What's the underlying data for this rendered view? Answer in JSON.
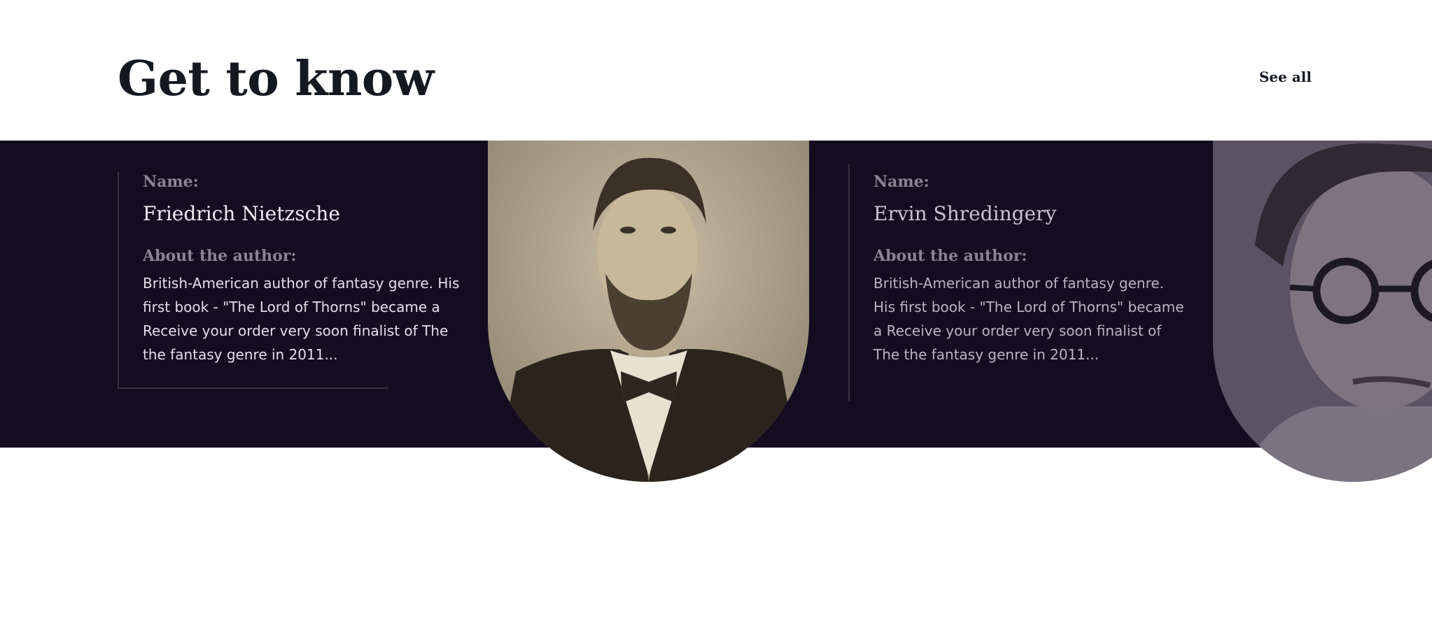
{
  "header": {
    "title": "Get to know",
    "see_all": "See all"
  },
  "authors": [
    {
      "name_label": "Name:",
      "name": "Friedrich Nietzsche",
      "about_label": "About the author:",
      "about": "British-American author of fantasy genre. His first book - \"The Lord of Thorns\" became a Receive your order very soon finalist of The the fantasy genre in 2011..."
    },
    {
      "name_label": "Name:",
      "name": "Ervin Shredingery",
      "about_label": "About the author:",
      "about": "British-American author of fantasy genre. His first book - \"The Lord of Thorns\" became a Receive your order very soon finalist of The the fantasy genre in 2011..."
    }
  ],
  "colors": {
    "band": "#130d1f",
    "title": "#141821",
    "label": "#8b8591"
  }
}
